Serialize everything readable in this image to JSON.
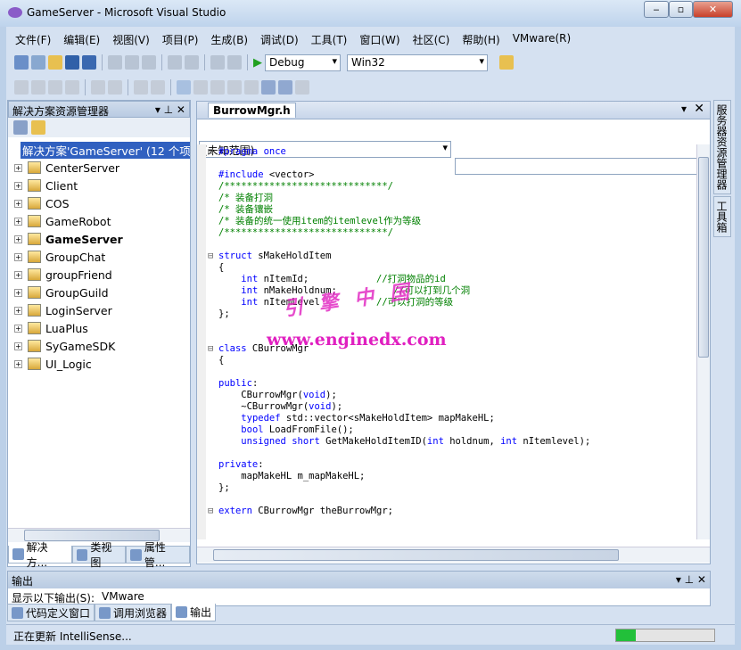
{
  "window": {
    "title": "GameServer - Microsoft Visual Studio",
    "min": "‒",
    "max": "▫",
    "close": "✕"
  },
  "menu": [
    "文件(F)",
    "编辑(E)",
    "视图(V)",
    "项目(P)",
    "生成(B)",
    "调试(D)",
    "工具(T)",
    "窗口(W)",
    "社区(C)",
    "帮助(H)",
    "VMware(R)"
  ],
  "toolbar": {
    "config": "Debug",
    "platform": "Win32"
  },
  "solution_explorer": {
    "title": "解决方案资源管理器",
    "pin": "▾ ⊥ ✕",
    "root": "解决方案'GameServer' (12 个项目)",
    "projects": [
      {
        "name": "CenterServer"
      },
      {
        "name": "Client"
      },
      {
        "name": "COS"
      },
      {
        "name": "GameRobot"
      },
      {
        "name": "GameServer",
        "bold": true
      },
      {
        "name": "GroupChat"
      },
      {
        "name": "groupFriend"
      },
      {
        "name": "GroupGuild"
      },
      {
        "name": "LoginServer"
      },
      {
        "name": "LuaPlus"
      },
      {
        "name": "SyGameSDK"
      },
      {
        "name": "UI_Logic"
      }
    ],
    "tabs": [
      "解决方...",
      "类视图",
      "属性管..."
    ]
  },
  "editor": {
    "tab": "BurrowMgr.h",
    "scope": "(未知范围)",
    "member": "",
    "lines": [
      [
        [
          "pp",
          "#pragma once"
        ]
      ],
      [],
      [
        [
          "pp",
          "#include "
        ],
        [
          "tx",
          "<vector>"
        ]
      ],
      [
        [
          "cm",
          "/*****************************/"
        ]
      ],
      [
        [
          "cm",
          "/* 装备打洞"
        ]
      ],
      [
        [
          "cm",
          "/* 装备镶嵌"
        ]
      ],
      [
        [
          "cm",
          "/* 装备的统一使用item的itemlevel作为等级"
        ]
      ],
      [
        [
          "cm",
          "/*****************************/"
        ]
      ],
      [],
      [
        [
          "kw",
          "struct"
        ],
        [
          "tx",
          " sMakeHoldItem"
        ]
      ],
      [
        [
          "tx",
          "{"
        ]
      ],
      [
        [
          "tx",
          "    "
        ],
        [
          "kw",
          "int"
        ],
        [
          "tx",
          " nItemId;            "
        ],
        [
          "cm",
          "//打洞物品的id"
        ]
      ],
      [
        [
          "tx",
          "    "
        ],
        [
          "kw",
          "int"
        ],
        [
          "tx",
          " nMakeHoldnum;          "
        ],
        [
          "cm",
          "//可以打到几个洞"
        ]
      ],
      [
        [
          "tx",
          "    "
        ],
        [
          "kw",
          "int"
        ],
        [
          "tx",
          " nItemLevel          "
        ],
        [
          "cm",
          "//可以打洞的等级"
        ]
      ],
      [
        [
          "tx",
          "};"
        ]
      ],
      [],
      [],
      [
        [
          "kw",
          "class"
        ],
        [
          "tx",
          " CBurrowMgr"
        ]
      ],
      [
        [
          "tx",
          "{"
        ]
      ],
      [],
      [
        [
          "kw",
          "public"
        ],
        [
          "tx",
          ":"
        ]
      ],
      [
        [
          "tx",
          "    CBurrowMgr("
        ],
        [
          "kw",
          "void"
        ],
        [
          "tx",
          ");"
        ]
      ],
      [
        [
          "tx",
          "    ~CBurrowMgr("
        ],
        [
          "kw",
          "void"
        ],
        [
          "tx",
          ");"
        ]
      ],
      [
        [
          "tx",
          "    "
        ],
        [
          "kw",
          "typedef"
        ],
        [
          "tx",
          " std::vector<sMakeHoldItem> mapMakeHL;"
        ]
      ],
      [
        [
          "tx",
          "    "
        ],
        [
          "kw",
          "bool"
        ],
        [
          "tx",
          " LoadFromFile();"
        ]
      ],
      [
        [
          "tx",
          "    "
        ],
        [
          "kw",
          "unsigned short"
        ],
        [
          "tx",
          " GetMakeHoldItemID("
        ],
        [
          "kw",
          "int"
        ],
        [
          "tx",
          " holdnum, "
        ],
        [
          "kw",
          "int"
        ],
        [
          "tx",
          " nItemlevel);"
        ]
      ],
      [],
      [
        [
          "kw",
          "private"
        ],
        [
          "tx",
          ":"
        ]
      ],
      [
        [
          "tx",
          "    mapMakeHL m_mapMakeHL;"
        ]
      ],
      [
        [
          "tx",
          "};"
        ]
      ],
      [],
      [
        [
          "kw",
          "extern"
        ],
        [
          "tx",
          " CBurrowMgr theBurrowMgr;"
        ]
      ]
    ],
    "folds": [
      0,
      9,
      17,
      31
    ],
    "watermark_url": "www.enginedx.com",
    "watermark_cn": "引擎中国"
  },
  "right_tabs": [
    "服务器资源管理器",
    "工具箱"
  ],
  "output": {
    "title": "输出",
    "show_label": "显示以下输出(S):",
    "source": "VMware"
  },
  "bottom_tabs": [
    "代码定义窗口",
    "调用浏览器",
    "输出"
  ],
  "status": {
    "text": "正在更新 IntelliSense...",
    "progress": 0.2
  },
  "colors": {
    "keyword": "#0000ff",
    "comment": "#008000",
    "progress": "#22c03a"
  }
}
